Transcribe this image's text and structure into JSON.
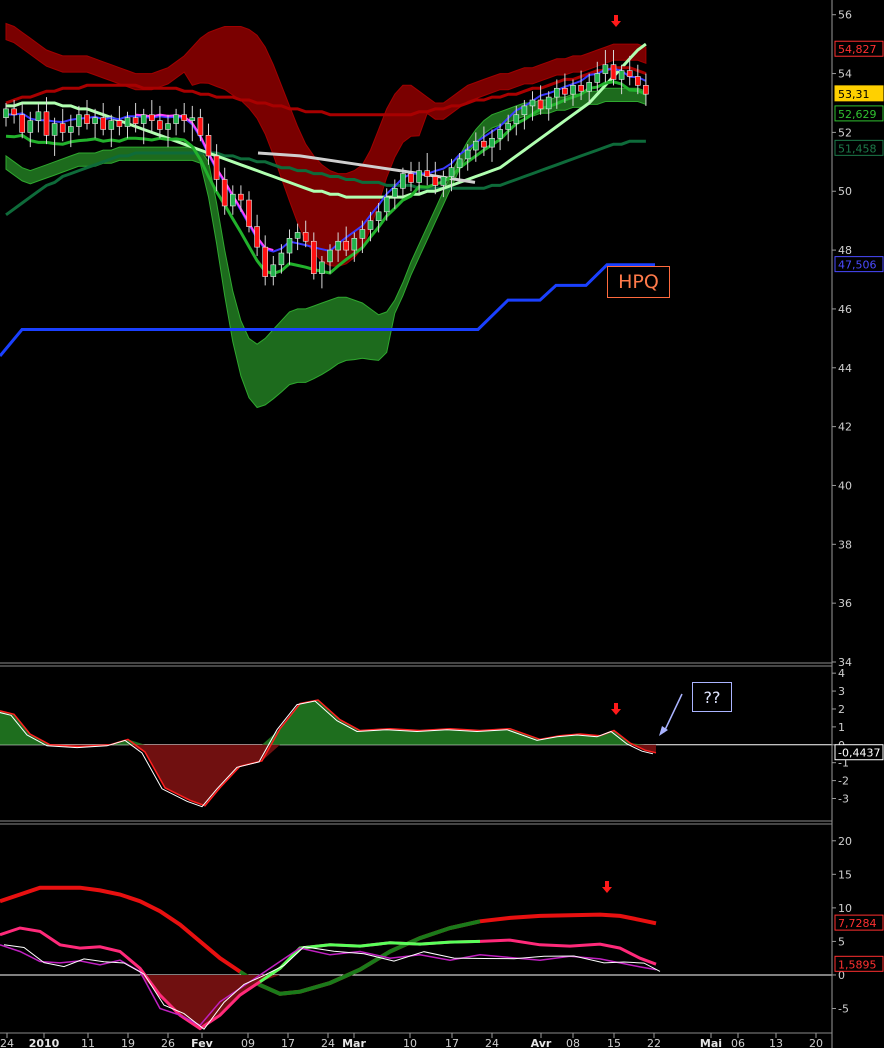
{
  "ticker": "HPQ",
  "annotation": "??",
  "colors": {
    "background": "#000000",
    "up_candle": "#22b24c",
    "down_candle": "#ff1010",
    "red_band": "#7a0000",
    "green_band": "#1d6b1d",
    "blue_line": "#3a3aff",
    "bright_blue": "#1a40ff",
    "magenta": "#ff40ff",
    "light_green": "#b0ffb0",
    "dark_green": "#0e6b3a",
    "osc_fill_pos": "#1e6e1e",
    "osc_fill_neg": "#701010",
    "red_line": "#e01010",
    "pink": "#ff2a7a",
    "purple": "#c020c0"
  },
  "chart_data": [
    {
      "type": "line",
      "title": "HPQ",
      "ylim": [
        34,
        56.5
      ],
      "y_ticks": [
        34,
        36,
        38,
        40,
        42,
        44,
        46,
        48,
        50,
        52,
        54,
        56
      ],
      "x_tick_labels": [
        "24",
        "2010",
        "11",
        "19",
        "26",
        "Fev",
        "09",
        "17",
        "24",
        "Mar",
        "10",
        "17",
        "24",
        "Avr",
        "08",
        "15",
        "22",
        "Mai",
        "06",
        "13",
        "20"
      ],
      "value_badges": [
        {
          "label": "54,827",
          "value": 54.827,
          "color": "#ff3030"
        },
        {
          "label": "53,31",
          "value": 53.31,
          "color": "#ffd000"
        },
        {
          "label": "52,629",
          "value": 52.629,
          "color": "#30c030"
        },
        {
          "label": "51,458",
          "value": 51.458,
          "color": "#1d7a4a"
        },
        {
          "label": "47,506",
          "value": 47.506,
          "color": "#4a4aff"
        }
      ],
      "candles": [
        [
          52.5,
          53.0,
          52.2,
          52.8
        ],
        [
          52.8,
          53.1,
          52.3,
          52.6
        ],
        [
          52.6,
          53.0,
          51.8,
          52.0
        ],
        [
          52.0,
          52.7,
          51.5,
          52.4
        ],
        [
          52.4,
          53.0,
          52.0,
          52.7
        ],
        [
          52.7,
          53.2,
          51.6,
          51.9
        ],
        [
          51.9,
          52.5,
          51.2,
          52.3
        ],
        [
          52.3,
          52.8,
          51.7,
          52.0
        ],
        [
          52.0,
          52.6,
          51.5,
          52.2
        ],
        [
          52.2,
          52.9,
          51.9,
          52.6
        ],
        [
          52.6,
          53.1,
          52.1,
          52.3
        ],
        [
          52.3,
          52.8,
          51.8,
          52.5
        ],
        [
          52.5,
          53.0,
          51.9,
          52.1
        ],
        [
          52.1,
          52.6,
          51.5,
          52.4
        ],
        [
          52.4,
          52.9,
          51.9,
          52.2
        ],
        [
          52.2,
          52.7,
          51.8,
          52.5
        ],
        [
          52.5,
          53.0,
          52.0,
          52.3
        ],
        [
          52.3,
          52.8,
          51.6,
          52.6
        ],
        [
          52.6,
          53.1,
          52.0,
          52.4
        ],
        [
          52.4,
          52.9,
          51.8,
          52.1
        ],
        [
          52.1,
          52.6,
          51.5,
          52.3
        ],
        [
          52.3,
          52.8,
          51.9,
          52.6
        ],
        [
          52.6,
          53.0,
          52.0,
          52.4
        ],
        [
          52.4,
          52.9,
          51.7,
          52.5
        ],
        [
          52.5,
          52.8,
          51.7,
          51.9
        ],
        [
          51.9,
          52.3,
          50.9,
          51.2
        ],
        [
          51.2,
          51.6,
          50.0,
          50.4
        ],
        [
          50.4,
          50.8,
          49.2,
          49.5
        ],
        [
          49.5,
          50.2,
          49.2,
          49.9
        ],
        [
          49.9,
          50.2,
          49.3,
          49.7
        ],
        [
          49.7,
          50.0,
          48.6,
          48.8
        ],
        [
          48.8,
          49.2,
          47.8,
          48.1
        ],
        [
          48.1,
          48.5,
          46.8,
          47.1
        ],
        [
          47.1,
          47.8,
          46.8,
          47.5
        ],
        [
          47.5,
          48.2,
          47.2,
          47.9
        ],
        [
          47.9,
          48.7,
          47.5,
          48.4
        ],
        [
          48.4,
          48.9,
          48.0,
          48.6
        ],
        [
          48.6,
          49.0,
          48.1,
          48.3
        ],
        [
          48.3,
          48.6,
          47.0,
          47.2
        ],
        [
          47.2,
          47.8,
          46.7,
          47.6
        ],
        [
          47.6,
          48.2,
          47.2,
          48.0
        ],
        [
          48.0,
          48.6,
          47.6,
          48.3
        ],
        [
          48.3,
          48.8,
          47.8,
          48.0
        ],
        [
          48.0,
          48.6,
          47.6,
          48.4
        ],
        [
          48.4,
          49.0,
          47.9,
          48.7
        ],
        [
          48.7,
          49.3,
          48.3,
          49.0
        ],
        [
          49.0,
          49.6,
          48.6,
          49.3
        ],
        [
          49.3,
          50.1,
          49.0,
          49.8
        ],
        [
          49.8,
          50.4,
          49.4,
          50.1
        ],
        [
          50.1,
          50.8,
          49.8,
          50.6
        ],
        [
          50.6,
          51.0,
          50.0,
          50.3
        ],
        [
          50.3,
          51.0,
          49.9,
          50.7
        ],
        [
          50.7,
          51.3,
          50.2,
          50.5
        ],
        [
          50.5,
          51.0,
          49.9,
          50.2
        ],
        [
          50.2,
          50.7,
          49.8,
          50.5
        ],
        [
          50.5,
          51.1,
          50.0,
          50.8
        ],
        [
          50.8,
          51.3,
          50.3,
          51.1
        ],
        [
          51.1,
          51.6,
          50.7,
          51.4
        ],
        [
          51.4,
          52.0,
          51.0,
          51.7
        ],
        [
          51.7,
          52.2,
          51.2,
          51.5
        ],
        [
          51.5,
          52.1,
          51.0,
          51.8
        ],
        [
          51.8,
          52.3,
          51.4,
          52.1
        ],
        [
          52.1,
          52.6,
          51.7,
          52.3
        ],
        [
          52.3,
          52.9,
          51.9,
          52.6
        ],
        [
          52.6,
          53.1,
          52.1,
          52.9
        ],
        [
          52.9,
          53.4,
          52.4,
          53.1
        ],
        [
          53.1,
          53.6,
          52.6,
          52.8
        ],
        [
          52.8,
          53.4,
          52.4,
          53.2
        ],
        [
          53.2,
          53.8,
          52.8,
          53.5
        ],
        [
          53.5,
          54.0,
          53.0,
          53.3
        ],
        [
          53.3,
          53.8,
          52.9,
          53.6
        ],
        [
          53.6,
          54.1,
          53.1,
          53.4
        ],
        [
          53.4,
          54.0,
          53.0,
          53.7
        ],
        [
          53.7,
          54.4,
          53.4,
          54.0
        ],
        [
          54.0,
          54.8,
          53.7,
          54.3
        ],
        [
          54.3,
          54.8,
          53.6,
          53.8
        ],
        [
          53.8,
          54.3,
          53.3,
          54.1
        ],
        [
          54.1,
          54.6,
          53.6,
          53.9
        ],
        [
          53.9,
          54.3,
          53.3,
          53.6
        ],
        [
          53.6,
          54.0,
          52.9,
          53.3
        ]
      ]
    },
    {
      "type": "area",
      "ylim": [
        -4.2,
        4.4
      ],
      "y_ticks": [
        -3,
        -2,
        -1,
        0,
        1,
        2,
        3,
        4
      ],
      "value_badges": [
        {
          "label": "-0,4437",
          "value": -0.4437,
          "color": "#ffffff"
        }
      ]
    },
    {
      "type": "line",
      "ylim": [
        -8.5,
        22.5
      ],
      "y_ticks": [
        -5,
        0,
        5,
        10,
        15,
        20
      ],
      "value_badges": [
        {
          "label": "7,7284",
          "value": 7.7284,
          "color": "#ff3030"
        },
        {
          "label": "1,5895",
          "value": 1.5895,
          "color": "#ff3030"
        }
      ]
    }
  ]
}
